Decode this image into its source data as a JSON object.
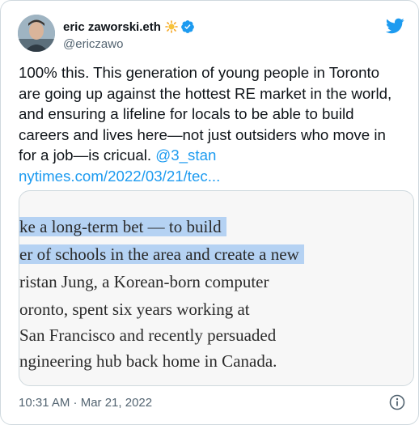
{
  "tweet": {
    "display_name": "eric zaworski.eth",
    "emoji_icon": "sun-emoji-icon",
    "verified_icon": "verified-badge-icon",
    "handle": "@ericzawo",
    "brand_icon": "twitter-bird-icon",
    "brand_color": "#1d9bf0",
    "text_main": "100% this. This generation of young people in Toronto are going up against the hottest RE market in the world, and ensuring a lifeline for locals to be able to build careers and lives here—not just outsiders who move in for a job—is cricual.",
    "mention": "@3_stan",
    "link": "nytimes.com/2022/03/21/tec...",
    "timestamp": "10:31 AM · Mar 21, 2022",
    "info_icon": "info-icon"
  },
  "media": {
    "highlight_color": "#b5d2f3",
    "lines": [
      "ke a long-term bet — to build",
      "er of schools in the area and create a new",
      "ristan Jung, a Korean-born computer",
      "oronto, spent six years working at",
      "San Francisco and recently persuaded",
      "ngineering hub back home in Canada."
    ]
  }
}
